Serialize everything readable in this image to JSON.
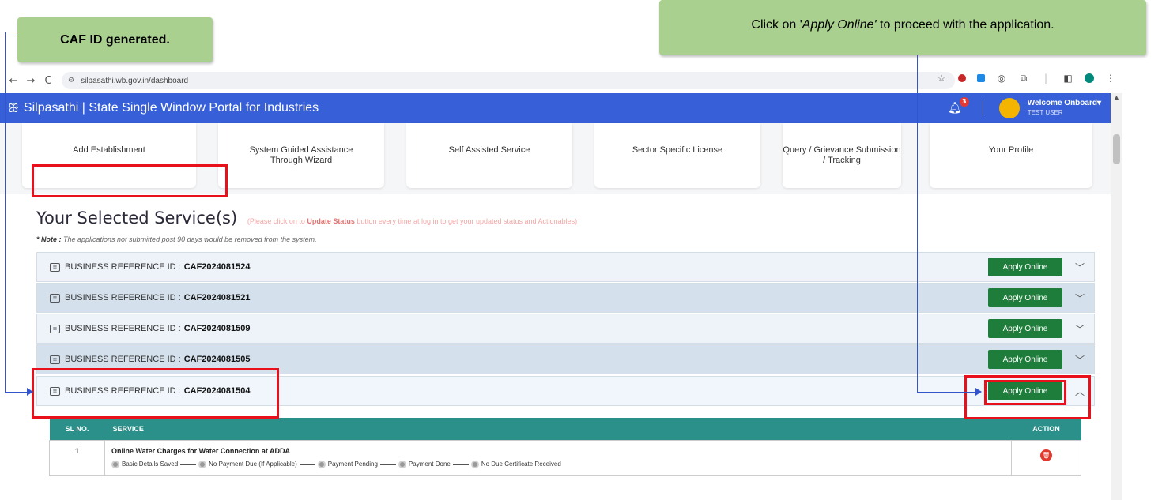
{
  "callouts": {
    "caf": "CAF ID generated.",
    "apply_prefix": "Click on '",
    "apply_em": "Apply Online'",
    "apply_suffix": " to proceed with the application."
  },
  "browser": {
    "back": "←",
    "forward": "→",
    "reload": "C",
    "url": "silpasathi.wb.gov.in/dashboard"
  },
  "header": {
    "logo_glyph": "ꕥ",
    "title": "Silpasathi | State Single Window Portal for Industries",
    "notification_count": "3",
    "welcome": "Welcome Onboard",
    "user": "TEST USER"
  },
  "cards": [
    {
      "label": "Add Establishment"
    },
    {
      "label": "System Guided Assistance Through Wizard"
    },
    {
      "label": "Self Assisted Service"
    },
    {
      "label": "Sector Specific License"
    },
    {
      "label": "Query / Grievance Submission / Tracking"
    },
    {
      "label": "Your Profile"
    }
  ],
  "section": {
    "title": "Your Selected Service(s)",
    "hint_pre": "(Please click on to ",
    "hint_bold": "Update Status",
    "hint_post": " button every time at log in to get your updated status and Actionables)",
    "note_label": "* Note :",
    "note_text": " The applications not submitted post 90 days would be removed from the system."
  },
  "rows": [
    {
      "label": "BUSINESS REFERENCE ID :",
      "id": "CAF2024081524",
      "button": "Apply Online"
    },
    {
      "label": "BUSINESS REFERENCE ID :",
      "id": "CAF2024081521",
      "button": "Apply Online"
    },
    {
      "label": "BUSINESS REFERENCE ID :",
      "id": "CAF2024081509",
      "button": "Apply Online"
    },
    {
      "label": "BUSINESS REFERENCE ID :",
      "id": "CAF2024081505",
      "button": "Apply Online"
    },
    {
      "label": "BUSINESS REFERENCE ID :",
      "id": "CAF2024081504",
      "button": "Apply Online"
    }
  ],
  "table": {
    "headers": [
      "SL NO.",
      "SERVICE",
      "ACTION"
    ],
    "rows": [
      {
        "sl": "1",
        "service": "Online Water Charges for Water Connection at ADDA",
        "steps": [
          "Basic Details Saved",
          "No Payment Due (If Applicable)",
          "Payment Pending",
          "Payment Done",
          "No Due Certificate Received"
        ]
      }
    ]
  }
}
